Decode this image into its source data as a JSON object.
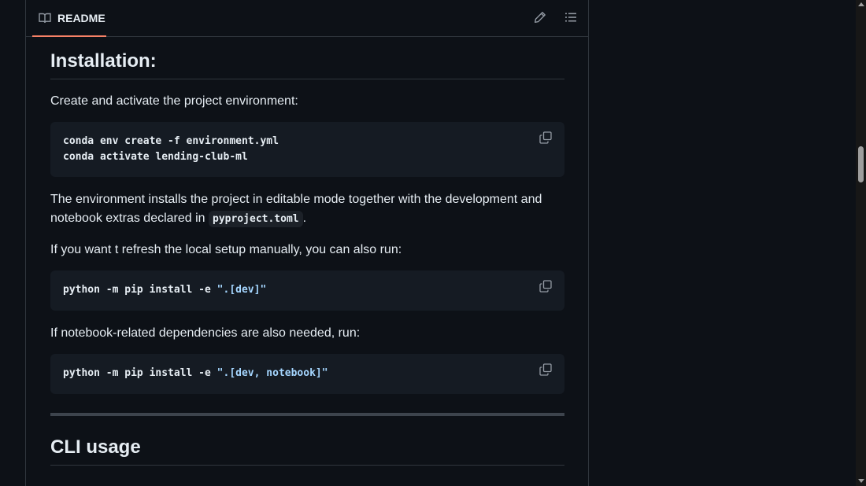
{
  "header": {
    "tab_label": "README",
    "tab_icon": "book-icon",
    "edit_icon": "pencil-icon",
    "outline_icon": "list-icon"
  },
  "sections": {
    "installation": {
      "heading": "Installation:",
      "intro": "Create and activate the project environment:",
      "code1_line1": "conda env create -f environment.yml",
      "code1_line2": "conda activate lending-club-ml",
      "para_env_part1": "The environment installs the project in editable mode together with the development and notebook extras declared in",
      "para_env_code": "pyproject.toml",
      "para_env_end": ".",
      "refresh_text": "If you want t refresh the local setup manually, you can also run:",
      "code2_cmd": "python -m pip install -e ",
      "code2_str": "\".[dev]\"",
      "notebook_text": "If notebook-related dependencies are also needed, run:",
      "code3_cmd": "python -m pip install -e ",
      "code3_str": "\".[dev, notebook]\""
    },
    "cli": {
      "heading": "CLI usage"
    }
  },
  "colors": {
    "background": "#0d1117",
    "code_background": "#151b23",
    "tab_underline": "#f78166",
    "string": "#a5d6ff",
    "border": "#30363d"
  }
}
